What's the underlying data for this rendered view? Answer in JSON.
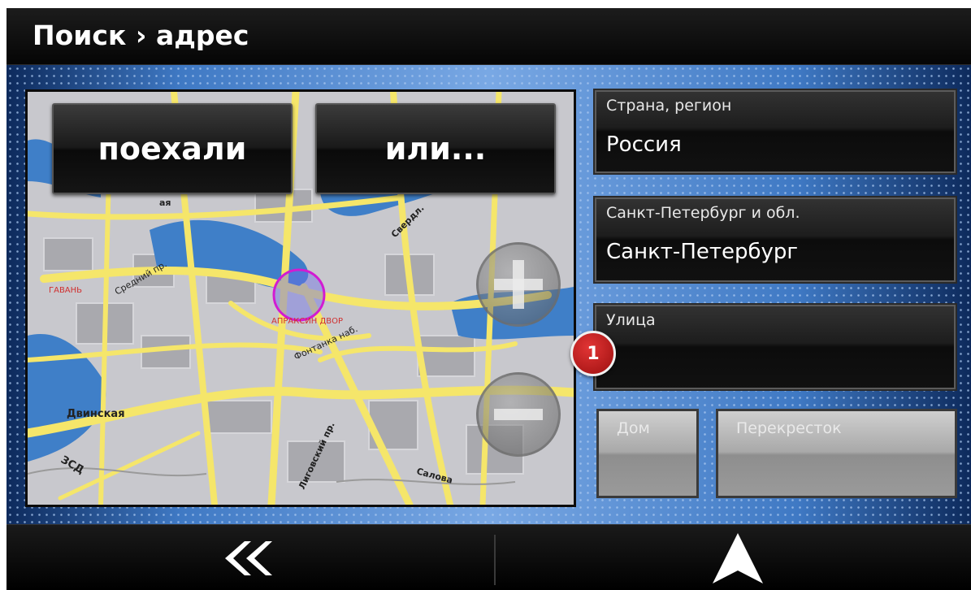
{
  "header": {
    "title": "Поиск › адрес"
  },
  "map": {
    "go_label": "поехали",
    "or_label": "или...",
    "labels": {
      "gavan": "ГАВАНЬ",
      "sredniy": "Средний пр.",
      "apraksin": "АПРАКСИН ДВОР",
      "fontanka": "Фонтанка наб.",
      "sverdl": "Свердл.",
      "dvinskaya": "Двинская",
      "zsd": "ЗСД",
      "ligovsky": "Лиговский пр.",
      "salova": "Салова",
      "aya": "ая"
    }
  },
  "form": {
    "country": {
      "label": "Страна, регион",
      "value": "Россия"
    },
    "region": {
      "label": "Санкт-Петербург и обл.",
      "value": "Санкт-Петербург"
    },
    "street": {
      "label": "Улица",
      "value": ""
    },
    "marker": "1",
    "house_label": "Дом",
    "crossroad_label": "Перекресток"
  },
  "colors": {
    "accent": "#3f79c4",
    "marker": "#d32626",
    "road": "#f5e66a",
    "water": "#3f7fc8"
  }
}
